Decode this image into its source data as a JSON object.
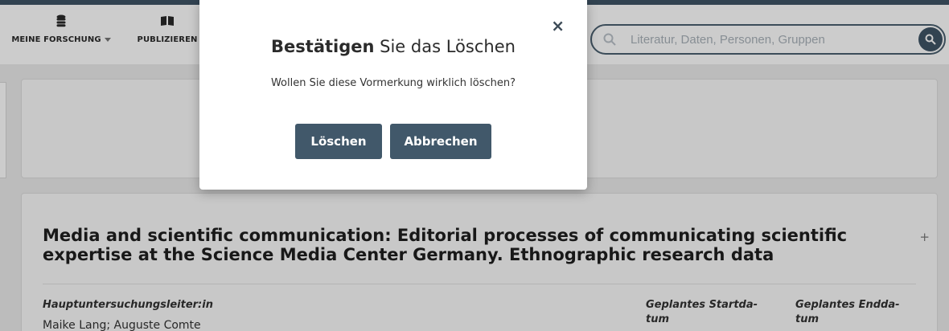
{
  "nav": {
    "items": [
      {
        "label": "MEINE FORSCHUNG",
        "icon": "database-icon"
      },
      {
        "label": "PUBLIZIEREN",
        "icon": "open-book-icon"
      }
    ]
  },
  "search": {
    "placeholder": "Literatur, Daten, Personen, Gruppen"
  },
  "publication": {
    "title": "Media and scientific communication: Editorial processes of communicating scientific experti­se at the Science Media Center Germany. Ethnographic research data",
    "pi_label": "Hauptuntersuchungsleiter:in",
    "pi_value": "Maike Lang; Auguste Comte",
    "start_label": "Geplantes Startda­tum",
    "end_label": "Geplantes Endda­tum"
  },
  "modal": {
    "title_bold": "Bestätigen",
    "title_rest": " Sie das Löschen",
    "message": "Wollen Sie diese Vormerkung wirklich löschen?",
    "confirm_label": "Löschen",
    "cancel_label": "Abbrechen",
    "close_symbol": "×"
  },
  "colors": {
    "accent": "#41586a",
    "nav_border": "#3f5466"
  }
}
